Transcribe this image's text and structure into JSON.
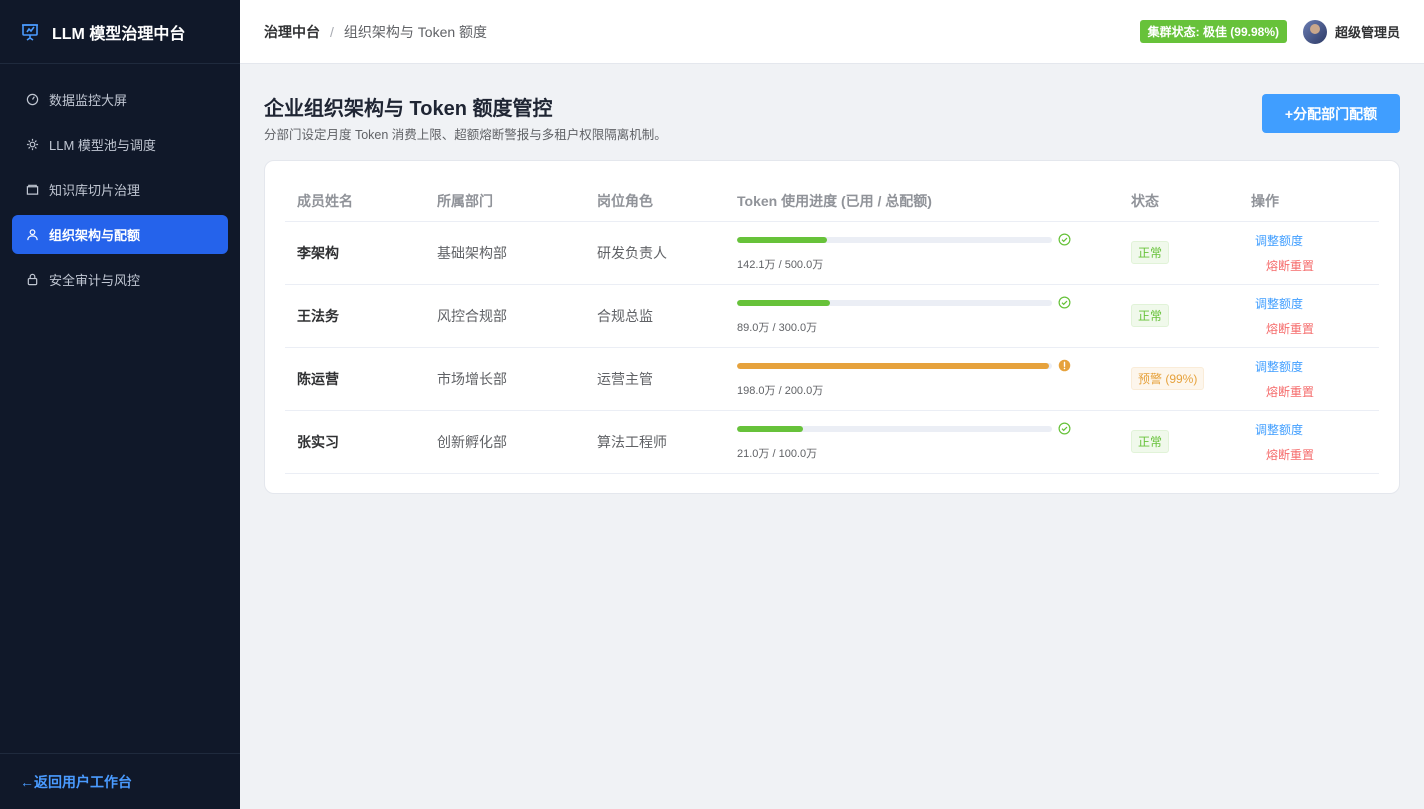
{
  "app": {
    "title": "LLM 模型治理中台"
  },
  "sidebar": {
    "items": [
      {
        "label": "数据监控大屏",
        "icon": "dashboard-gauge-icon",
        "active": false
      },
      {
        "label": "LLM 模型池与调度",
        "icon": "gear-icon",
        "active": false
      },
      {
        "label": "知识库切片治理",
        "icon": "folder-icon",
        "active": false
      },
      {
        "label": "组织架构与配额",
        "icon": "user-icon",
        "active": true
      },
      {
        "label": "安全审计与风控",
        "icon": "lock-icon",
        "active": false
      }
    ],
    "footer_link": "←返回用户工作台"
  },
  "header": {
    "breadcrumb_root": "治理中台",
    "breadcrumb_sep": "/",
    "breadcrumb_current": "组织架构与 Token 额度",
    "cluster_status": "集群状态: 极佳 (99.98%)",
    "username": "超级管理员"
  },
  "page": {
    "title": "企业组织架构与 Token 额度管控",
    "description": "分部门设定月度 Token 消费上限、超额熔断警报与多租户权限隔离机制。",
    "primary_button": "+分配部门配额"
  },
  "table": {
    "columns": [
      "成员姓名",
      "所属部门",
      "岗位角色",
      "Token 使用进度 (已用 / 总配额)",
      "状态",
      "操作"
    ],
    "rows": [
      {
        "name": "李架构",
        "dept": "基础架构部",
        "role": "研发负责人",
        "usage_text": "142.1万 / 500.0万",
        "usage_ratio": 0.2842,
        "status": "正常",
        "status_type": "ok",
        "action_adjust": "调整额度",
        "action_reset": "熔断重置"
      },
      {
        "name": "王法务",
        "dept": "风控合规部",
        "role": "合规总监",
        "usage_text": "89.0万 / 300.0万",
        "usage_ratio": 0.2967,
        "status": "正常",
        "status_type": "ok",
        "action_adjust": "调整额度",
        "action_reset": "熔断重置"
      },
      {
        "name": "陈运营",
        "dept": "市场增长部",
        "role": "运营主管",
        "usage_text": "198.0万 / 200.0万",
        "usage_ratio": 0.99,
        "status": "预警 (99%)",
        "status_type": "warn",
        "action_adjust": "调整额度",
        "action_reset": "熔断重置"
      },
      {
        "name": "张实习",
        "dept": "创新孵化部",
        "role": "算法工程师",
        "usage_text": "21.0万 / 100.0万",
        "usage_ratio": 0.21,
        "status": "正常",
        "status_type": "ok",
        "action_adjust": "调整额度",
        "action_reset": "熔断重置"
      }
    ]
  },
  "colors": {
    "sidebar_bg": "#101829",
    "active_menu": "#2563eb",
    "primary": "#409eff",
    "ok": "#67c23a",
    "warn": "#e6a23c",
    "danger": "#f56c6c"
  }
}
